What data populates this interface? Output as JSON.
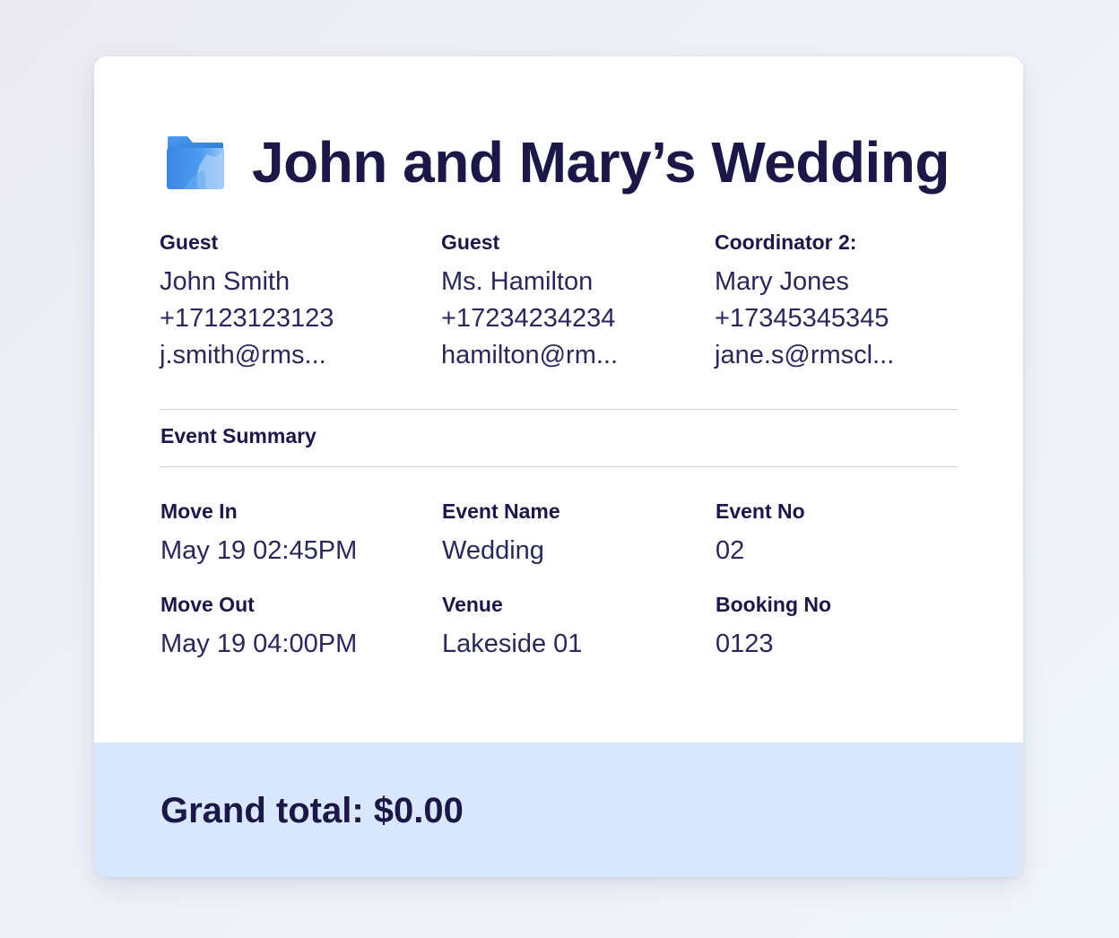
{
  "event": {
    "title": "John and Mary’s Wedding",
    "icon": "folder-icon"
  },
  "contacts": [
    {
      "label": "Guest",
      "name": "John Smith",
      "phone": "+17123123123",
      "email": "j.smith@rms..."
    },
    {
      "label": "Guest",
      "name": "Ms. Hamilton",
      "phone": "+17234234234",
      "email": "hamilton@rm..."
    },
    {
      "label": "Coordinator 2:",
      "name": "Mary Jones",
      "phone": "+17345345345",
      "email": "jane.s@rmscl..."
    }
  ],
  "summary": {
    "title": "Event Summary",
    "move_in": {
      "label": "Move In",
      "value": "May 19 02:45PM"
    },
    "event_name": {
      "label": "Event Name",
      "value": "Wedding"
    },
    "event_no": {
      "label": "Event No",
      "value": "02"
    },
    "move_out": {
      "label": "Move Out",
      "value": "May 19 04:00PM"
    },
    "venue": {
      "label": "Venue",
      "value": "Lakeside 01"
    },
    "booking_no": {
      "label": "Booking No",
      "value": "0123"
    }
  },
  "footer": {
    "grand_total": "Grand total: $0.00"
  },
  "colors": {
    "text_primary": "#1b1848",
    "footer_background": "#d8e7fb",
    "icon_blue": "#3f8ee6"
  }
}
